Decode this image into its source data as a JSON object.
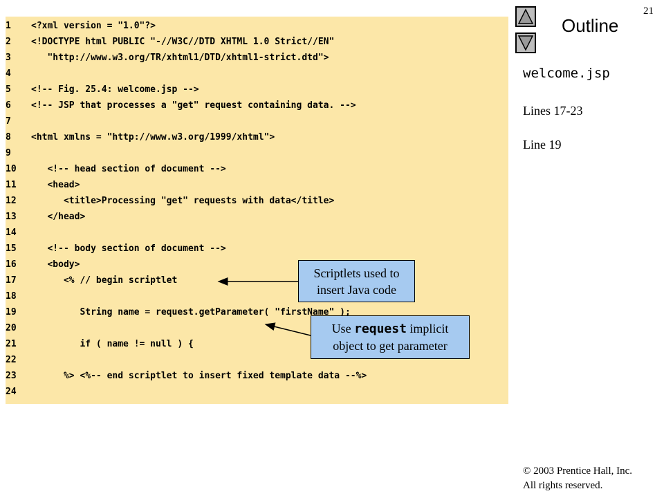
{
  "slide": {
    "page_number": "21",
    "outline_label": "Outline"
  },
  "sidebar": {
    "filename": "welcome.jsp",
    "notes": [
      "Lines 17-23",
      "Line 19"
    ]
  },
  "code": {
    "lines": [
      {
        "n": "1",
        "t": "<?xml version = \"1.0\"?>"
      },
      {
        "n": "2",
        "t": "<!DOCTYPE html PUBLIC \"-//W3C//DTD XHTML 1.0 Strict//EN\""
      },
      {
        "n": "3",
        "t": "   \"http://www.w3.org/TR/xhtml1/DTD/xhtml1-strict.dtd\">"
      },
      {
        "n": "4",
        "t": ""
      },
      {
        "n": "5",
        "t": "<!-- Fig. 25.4: welcome.jsp -->"
      },
      {
        "n": "6",
        "t": "<!-- JSP that processes a \"get\" request containing data. -->"
      },
      {
        "n": "7",
        "t": ""
      },
      {
        "n": "8",
        "t": "<html xmlns = \"http://www.w3.org/1999/xhtml\">"
      },
      {
        "n": "9",
        "t": ""
      },
      {
        "n": "10",
        "t": "   <!-- head section of document -->"
      },
      {
        "n": "11",
        "t": "   <head>"
      },
      {
        "n": "12",
        "t": "      <title>Processing \"get\" requests with data</title>"
      },
      {
        "n": "13",
        "t": "   </head>"
      },
      {
        "n": "14",
        "t": ""
      },
      {
        "n": "15",
        "t": "   <!-- body section of document -->"
      },
      {
        "n": "16",
        "t": "   <body>"
      },
      {
        "n": "17",
        "t": "      <% // begin scriptlet"
      },
      {
        "n": "18",
        "t": ""
      },
      {
        "n": "19",
        "t": "         String name = request.getParameter( \"firstName\" );"
      },
      {
        "n": "20",
        "t": ""
      },
      {
        "n": "21",
        "t": "         if ( name != null ) {"
      },
      {
        "n": "22",
        "t": ""
      },
      {
        "n": "23",
        "t": "      %> <%-- end scriptlet to insert fixed template data --%>"
      },
      {
        "n": "24",
        "t": ""
      }
    ]
  },
  "callouts": {
    "scriptlets": {
      "line1": "Scriptlets used to",
      "line2": "insert Java code"
    },
    "request": {
      "prefix": "Use ",
      "code": "request",
      "suffix": " implicit",
      "line2": "object to get parameter"
    }
  },
  "footer": {
    "copyright": "© 2003 Prentice Hall, Inc.",
    "rights": "All rights reserved."
  },
  "colors": {
    "code_background": "#FCE7A8",
    "callout_background": "#A6CAF0",
    "nav_button": "#bdbdbd"
  },
  "icons": {
    "previous": "triangle-up-icon",
    "next": "triangle-down-icon"
  }
}
